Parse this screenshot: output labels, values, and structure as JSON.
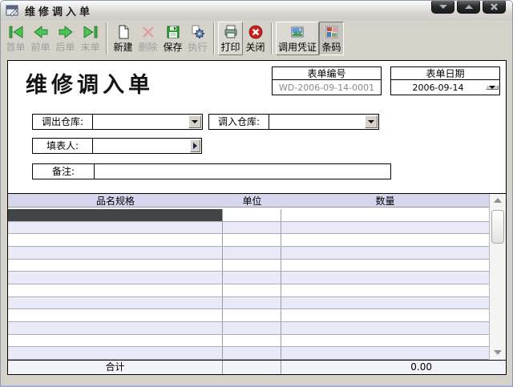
{
  "window": {
    "title": "维修调入单"
  },
  "toolbar": {
    "buttons": [
      {
        "label": "首单",
        "icon": "first-record-icon",
        "enabled": false
      },
      {
        "label": "前单",
        "icon": "prev-record-icon",
        "enabled": false
      },
      {
        "label": "后单",
        "icon": "next-record-icon",
        "enabled": false
      },
      {
        "label": "末单",
        "icon": "last-record-icon",
        "enabled": false
      },
      {
        "label": "新建",
        "icon": "new-doc-icon",
        "enabled": true
      },
      {
        "label": "删除",
        "icon": "delete-icon",
        "enabled": false
      },
      {
        "label": "保存",
        "icon": "save-icon",
        "enabled": true
      },
      {
        "label": "执行",
        "icon": "execute-icon",
        "enabled": false
      },
      {
        "label": "打印",
        "icon": "print-icon",
        "enabled": true,
        "hot": true
      },
      {
        "label": "关闭",
        "icon": "close-app-icon",
        "enabled": true
      },
      {
        "label": "调用凭证",
        "icon": "voucher-icon",
        "enabled": true,
        "hot": true
      },
      {
        "label": "条码",
        "icon": "barcode-icon",
        "enabled": true,
        "pressed": true
      }
    ]
  },
  "form": {
    "title": "维修调入单",
    "doc_no": {
      "label": "表单编号",
      "value": "WD-2006-09-14-0001"
    },
    "doc_date": {
      "label": "表单日期",
      "value": "2006-09-14"
    },
    "out_warehouse": {
      "label": "调出仓库:",
      "value": ""
    },
    "in_warehouse": {
      "label": "调入仓库:",
      "value": ""
    },
    "filler": {
      "label": "填表人:",
      "value": ""
    },
    "remark": {
      "label": "备注:",
      "value": ""
    }
  },
  "grid": {
    "columns": [
      "品名规格",
      "单位",
      "数量"
    ],
    "rows": [
      [
        "",
        "",
        ""
      ],
      [
        "",
        "",
        ""
      ],
      [
        "",
        "",
        ""
      ],
      [
        "",
        "",
        ""
      ],
      [
        "",
        "",
        ""
      ],
      [
        "",
        "",
        ""
      ],
      [
        "",
        "",
        ""
      ],
      [
        "",
        "",
        ""
      ],
      [
        "",
        "",
        ""
      ],
      [
        "",
        "",
        ""
      ],
      [
        "",
        "",
        ""
      ],
      [
        "",
        "",
        ""
      ]
    ],
    "selected_cell": {
      "row": 0,
      "col": 0
    },
    "footer": {
      "label": "合计",
      "unit": "",
      "total": "0.00"
    }
  },
  "colors": {
    "grid_header_bg": "#d6d6ee",
    "grid_alt_row_bg": "#e9e9f7",
    "selected_cell_bg": "#3f4645",
    "footer_bg": "#f3f3fb",
    "window_bg": "#d5d2ca",
    "toolbar_green": "#3fae4a",
    "close_red": "#cc2020"
  }
}
